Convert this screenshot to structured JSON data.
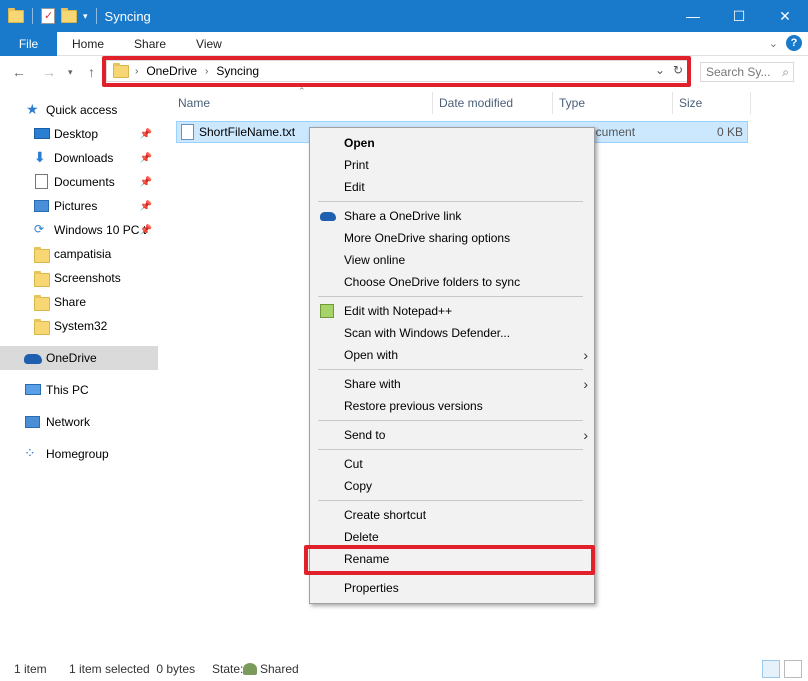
{
  "window": {
    "title": "Syncing"
  },
  "ribbon": {
    "file": "File",
    "tabs": [
      "Home",
      "Share",
      "View"
    ]
  },
  "address": {
    "crumbs": [
      "OneDrive",
      "Syncing"
    ],
    "search_placeholder": "Search Sy..."
  },
  "sidebar": {
    "items": [
      {
        "label": "Quick access",
        "icon": "star-icon"
      },
      {
        "label": "Desktop",
        "icon": "desktop-icon",
        "pinned": true
      },
      {
        "label": "Downloads",
        "icon": "download-icon",
        "pinned": true
      },
      {
        "label": "Documents",
        "icon": "document-icon",
        "pinned": true
      },
      {
        "label": "Pictures",
        "icon": "pictures-icon",
        "pinned": true
      },
      {
        "label": "Windows 10 PC t",
        "icon": "sync-folder-icon",
        "pinned": true
      },
      {
        "label": "campatisia",
        "icon": "folder-icon"
      },
      {
        "label": "Screenshots",
        "icon": "folder-icon"
      },
      {
        "label": "Share",
        "icon": "folder-icon"
      },
      {
        "label": "System32",
        "icon": "folder-icon"
      },
      {
        "label": "OneDrive",
        "icon": "onedrive-icon",
        "selected": true
      },
      {
        "label": "This PC",
        "icon": "pc-icon"
      },
      {
        "label": "Network",
        "icon": "network-icon"
      },
      {
        "label": "Homegroup",
        "icon": "homegroup-icon"
      }
    ]
  },
  "columns": [
    "Name",
    "Date modified",
    "Type",
    "Size"
  ],
  "file": {
    "name": "ShortFileName.txt",
    "type": "ocument",
    "size": "0 KB"
  },
  "menu": {
    "open": "Open",
    "print": "Print",
    "edit": "Edit",
    "share_link": "Share a OneDrive link",
    "more_sharing": "More OneDrive sharing options",
    "view_online": "View online",
    "choose_folders": "Choose OneDrive folders to sync",
    "edit_notepad": "Edit with Notepad++",
    "scan_defender": "Scan with Windows Defender...",
    "open_with": "Open with",
    "share_with": "Share with",
    "restore": "Restore previous versions",
    "send_to": "Send to",
    "cut": "Cut",
    "copy": "Copy",
    "create_shortcut": "Create shortcut",
    "delete": "Delete",
    "rename": "Rename",
    "properties": "Properties"
  },
  "status": {
    "items": "1 item",
    "selected": "1 item selected  0 bytes",
    "state_label": "State:",
    "state_value": "Shared"
  },
  "colors": {
    "accent": "#1979ca",
    "highlight": "#e0202a",
    "selection": "#cce8ff"
  }
}
